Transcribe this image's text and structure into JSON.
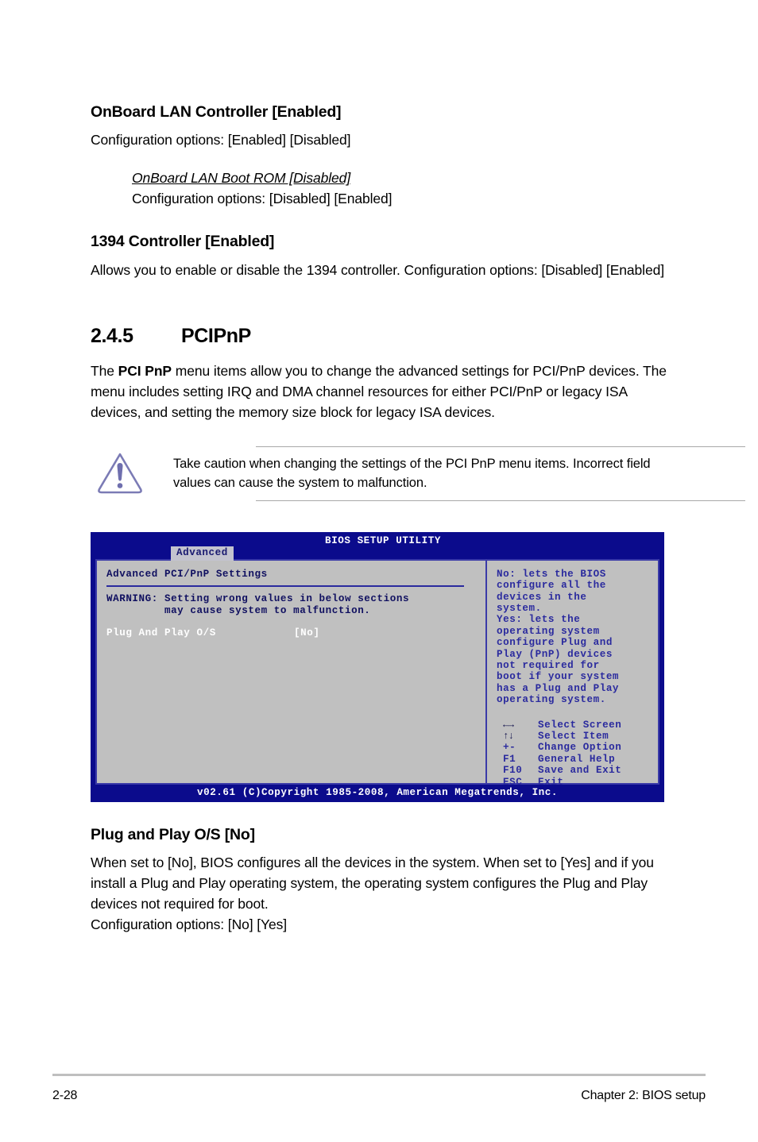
{
  "sections": {
    "onboard_lan": {
      "heading": "OnBoard LAN Controller [Enabled]",
      "body": "Configuration options: [Enabled] [Disabled]",
      "sub_heading": "OnBoard LAN Boot ROM [Disabled]",
      "sub_body": "Configuration options: [Disabled] [Enabled]"
    },
    "controller_1394": {
      "heading": "1394 Controller [Enabled]",
      "body": "Allows you to enable or disable the 1394 controller. Configuration options: [Disabled] [Enabled]"
    },
    "pcipnp": {
      "number": "2.4.5",
      "title": "PCIPnP",
      "intro_part1": "The ",
      "intro_bold": "PCI PnP",
      "intro_part2": " menu items allow you to change the advanced settings for PCI/PnP devices. The menu includes setting IRQ and DMA channel resources for either PCI/PnP or legacy ISA devices, and setting the memory size block for legacy ISA devices."
    },
    "plug_and_play": {
      "heading": "Plug and Play O/S [No]",
      "body": "When set to [No], BIOS configures all the devices in the system. When set to [Yes] and if you install a Plug and Play operating system, the operating system configures the Plug and Play devices not required for boot.",
      "options": "Configuration options: [No] [Yes]"
    }
  },
  "caution_note": {
    "icon": "caution-triangle-icon",
    "text": "Take caution when changing the settings of the PCI PnP menu items. Incorrect field values can cause the system to malfunction.",
    "icon_color": "#7b7bb5"
  },
  "bios_screen": {
    "title": "BIOS SETUP UTILITY",
    "active_tab": "Advanced",
    "panel_heading": "Advanced PCI/PnP Settings",
    "warning_line1": "WARNING: Setting wrong values in below sections",
    "warning_line2": "         may cause system to malfunction.",
    "setting_label": "Plug And Play O/S",
    "setting_value": "[No]",
    "help_lines": [
      "No: lets the BIOS",
      "configure all the",
      "devices in the",
      "system.",
      "Yes: lets the",
      "operating system",
      "configure Plug and",
      "Play (PnP) devices",
      "not required for",
      "boot if your system",
      "has a Plug and Play",
      "operating system."
    ],
    "legend": [
      {
        "key": "←→",
        "label": "Select Screen",
        "glyph": true
      },
      {
        "key": "↑↓",
        "label": "Select Item",
        "glyph": true
      },
      {
        "key": "+-",
        "label": "Change Option",
        "glyph": false
      },
      {
        "key": "F1",
        "label": "General Help",
        "glyph": false
      },
      {
        "key": "F10",
        "label": "Save and Exit",
        "glyph": false
      },
      {
        "key": "ESC",
        "label": "Exit",
        "glyph": false
      }
    ],
    "footer": "v02.61 (C)Copyright 1985-2008, American Megatrends, Inc.",
    "colors": {
      "header_blue": "#0b0b8c",
      "panel_gray": "#c0c0c0",
      "text_blue": "#13137d",
      "border_blue": "#3a3aa8"
    }
  },
  "page_footer": {
    "page_number": "2-28",
    "chapter": "Chapter 2: BIOS setup"
  }
}
